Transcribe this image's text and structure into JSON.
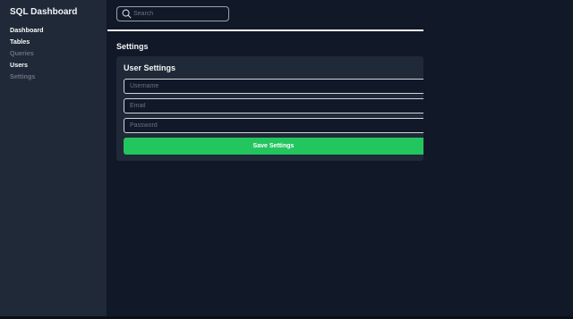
{
  "sidebar": {
    "title": "SQL Dashboard",
    "items": [
      {
        "label": "Dashboard",
        "state": "active"
      },
      {
        "label": "Tables",
        "state": "active"
      },
      {
        "label": "Queries",
        "state": "muted"
      },
      {
        "label": "Users",
        "state": "active"
      },
      {
        "label": "Settings",
        "state": "muted"
      }
    ]
  },
  "header": {
    "search": {
      "placeholder": "Search",
      "icon": "search-icon",
      "value": ""
    }
  },
  "main": {
    "page_title": "Settings",
    "user_settings": {
      "title": "User Settings",
      "username_placeholder": "Username",
      "email_placeholder": "Email",
      "password_placeholder": "Password",
      "save_label": "Save Settings"
    }
  },
  "colors": {
    "background": "#111827",
    "sidebar": "#1f2937",
    "card": "#1f2937",
    "accent": "#22c55e",
    "text": "#f3f4f6",
    "muted_text": "#6b7280"
  }
}
